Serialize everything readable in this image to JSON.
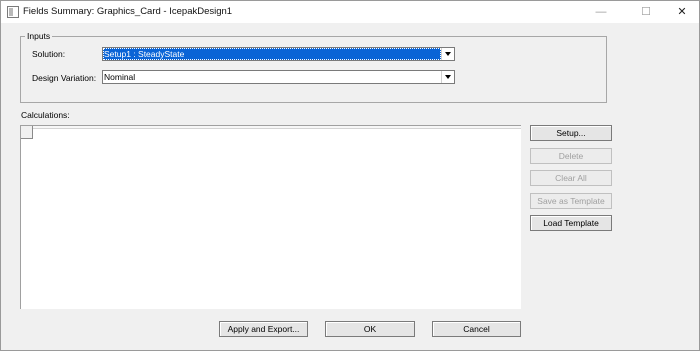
{
  "window": {
    "title": "Fields Summary: Graphics_Card - IcepakDesign1",
    "min_glyph": "—",
    "max_glyph": "☐",
    "close_glyph": "✕"
  },
  "inputs": {
    "group_label": "Inputs",
    "solution_label": "Solution:",
    "solution_value": "Setup1 : SteadyState",
    "design_variation_label": "Design Variation:",
    "design_variation_value": "Nominal"
  },
  "calculations": {
    "label": "Calculations:"
  },
  "side_buttons": {
    "setup": "Setup...",
    "delete": "Delete",
    "clear_all": "Clear All",
    "save_as_template": "Save as Template",
    "load_template": "Load Template"
  },
  "bottom_buttons": {
    "apply_export": "Apply and Export...",
    "ok": "OK",
    "cancel": "Cancel"
  },
  "colors": {
    "selection": "#0a64d6",
    "background": "#f0f0f0"
  }
}
